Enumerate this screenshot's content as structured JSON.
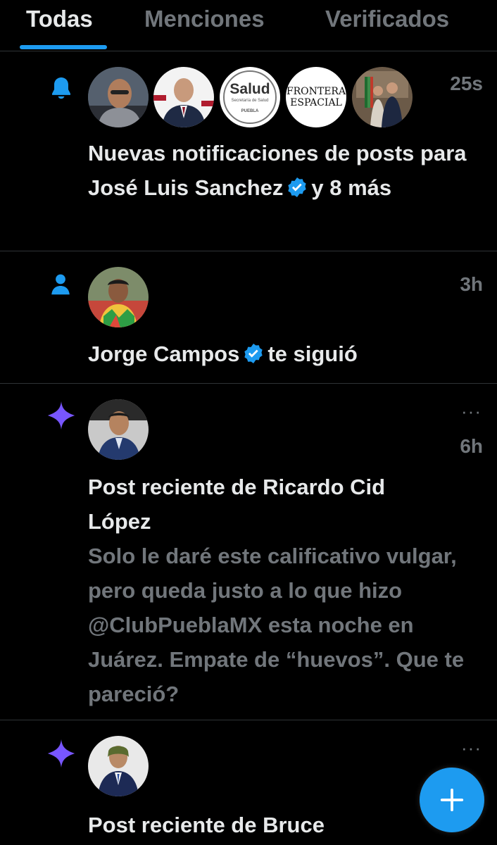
{
  "tabs": [
    {
      "label": "Todas",
      "active": true
    },
    {
      "label": "Menciones",
      "active": false
    },
    {
      "label": "Verificados",
      "active": false
    }
  ],
  "notifications": [
    {
      "icon": "bell-icon",
      "time": "25s",
      "avatars": [
        {
          "name": "avatar-man-glasses"
        },
        {
          "name": "avatar-man-suit"
        },
        {
          "name": "avatar-salud-logo",
          "text": "Salud",
          "subtext": "Secretaría de Salud",
          "tag": "PUEBLA"
        },
        {
          "name": "avatar-frontera-espacial-logo",
          "text1": "FRONTERA",
          "text2": "ESPACIAL"
        },
        {
          "name": "avatar-group-photo"
        }
      ],
      "text_before": "Nuevas notificaciones de posts para José Luis Sanchez",
      "text_after": "y 8 más"
    },
    {
      "icon": "person-icon",
      "time": "3h",
      "name": "Jorge Campos",
      "action": "te siguió"
    },
    {
      "icon": "sparkle-icon",
      "time": "6h",
      "more": "···",
      "title": "Post reciente de Ricardo Cid López",
      "snippet": "Solo le daré este calificativo vulgar, pero queda justo a lo que hizo @ClubPueblaMX esta noche en Juárez. Empate de “huevos”. Que te pareció?"
    },
    {
      "icon": "sparkle-icon",
      "more": "···",
      "title": "Post reciente de Bruce"
    }
  ],
  "colors": {
    "background": "#000000",
    "accent": "#1d9bf0",
    "sparkle": "#7856ff",
    "text_primary": "#e7e9ea",
    "text_secondary": "#71767b",
    "divider": "#2f3336"
  },
  "fab": {
    "icon": "plus-icon"
  }
}
